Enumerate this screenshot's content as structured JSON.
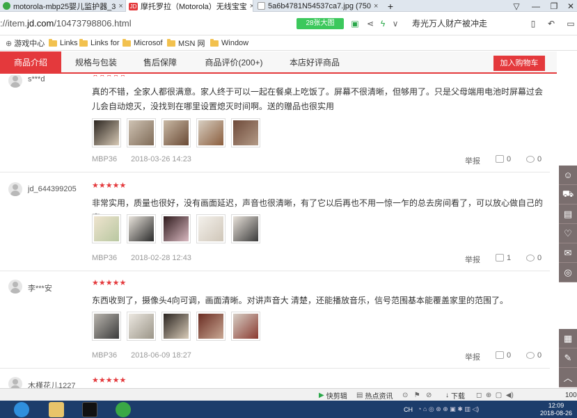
{
  "browser": {
    "tabs": [
      {
        "title": "motorola-mbp25婴儿监护器_3",
        "close": "×",
        "active": false,
        "favicon_color": "#3aa845"
      },
      {
        "title": "摩托罗拉（Motorola）无线宝宝",
        "close": "×",
        "active": true,
        "favicon_label": "JD",
        "favicon_color": "#e4393c"
      },
      {
        "title": "5a6b4781N54537ca7.jpg (750",
        "close": "×",
        "active": false,
        "favicon_color": "#bbbbbb"
      }
    ],
    "new_tab": "+",
    "window_buttons": [
      "▽",
      "—",
      "❐",
      "✕"
    ],
    "url_prefix": "://item.",
    "url_domain": "jd.com",
    "url_suffix": "/10473798806.html",
    "big_image_button": "28张大图",
    "address_icons": [
      "image-icon",
      "share-icon",
      "lightning-icon",
      "chevron-down-icon"
    ],
    "news_text": "寿光万人财产被冲走",
    "toolbar_icons": [
      "phone-icon",
      "undo-icon",
      "bookmark-icon"
    ]
  },
  "bookmarks": [
    {
      "label": "游戏中心",
      "icon": "gamepad-icon"
    },
    {
      "label": "Links",
      "icon": "folder-icon"
    },
    {
      "label": "Links for",
      "icon": "folder-icon"
    },
    {
      "label": "Microsof",
      "icon": "folder-icon"
    },
    {
      "label": "MSN 网",
      "icon": "folder-icon"
    },
    {
      "label": "Window",
      "icon": "folder-icon"
    }
  ],
  "nav": {
    "tabs": [
      "商品介绍",
      "规格与包装",
      "售后保障",
      "商品评价(200+)",
      "本店好评商品"
    ],
    "active_index": 0,
    "cart_button": "加入购物车"
  },
  "reviews": [
    {
      "user": "s***d",
      "stars": "★★★★★",
      "text": "真的不错，全家人都很满意。家人终于可以一起在餐桌上吃饭了。屏幕不很清晰，但够用了。只是父母端用电池时屏幕过会儿会自动熄灭，没找到在哪里设置熄灭时间啊。送的赠品也很实用",
      "thumb_colors": [
        [
          "#2b2520",
          "#d7c9b5"
        ],
        [
          "#cfc3b4",
          "#7f6b57"
        ],
        [
          "#c9b9a5",
          "#6a4a35"
        ],
        [
          "#d8cfc2",
          "#8a5d3d"
        ],
        [
          "#6e4a3a",
          "#b39a86"
        ]
      ],
      "model": "MBP36",
      "date": "2018-03-26 14:23",
      "report": "举报",
      "likes": "0",
      "comments": "0"
    },
    {
      "user": "jd_644399205",
      "stars": "★★★★★",
      "text": "非常实用，质量也很好，没有画面延迟，声音也很清晰，有了它以后再也不用一惊一乍的总去房间看了，可以放心做自己的事。",
      "thumb_colors": [
        [
          "#efe4cf",
          "#b8c7a0"
        ],
        [
          "#e9e4dc",
          "#2a2a2a"
        ],
        [
          "#2e1a1c",
          "#d9b8c0"
        ],
        [
          "#f4f1ec",
          "#cfc6b8"
        ],
        [
          "#e8e2da",
          "#3b3b3b"
        ]
      ],
      "model": "MBP36",
      "date": "2018-02-28 12:43",
      "report": "举报",
      "likes": "1",
      "comments": "0"
    },
    {
      "user": "李***安",
      "stars": "★★★★★",
      "text": "东西收到了，摄像头4向可调，画面清晰。对讲声音大 清楚，还能播放音乐，信号范围基本能覆盖家里的范围了。",
      "thumb_colors": [
        [
          "#b9b5ae",
          "#3b3b3b"
        ],
        [
          "#ece8e1",
          "#9b9588"
        ],
        [
          "#2a2420",
          "#d8cbb8"
        ],
        [
          "#6a2c22",
          "#c9a894"
        ],
        [
          "#d7cfc6",
          "#8a3a30"
        ]
      ],
      "model": "MBP36",
      "date": "2018-06-09 18:27",
      "report": "举报",
      "likes": "0",
      "comments": "0"
    },
    {
      "user": "木槿花儿1227",
      "stars": "★★★★★"
    }
  ],
  "side_tools": [
    "user-icon",
    "cart-icon",
    "coupon-icon",
    "heart-icon",
    "message-icon",
    "feedback-icon"
  ],
  "side_tools_bottom": [
    "qr-icon",
    "edit-icon",
    "top-icon"
  ],
  "statusbar": {
    "items": [
      {
        "label": "快剪辑",
        "icon": "play-icon"
      },
      {
        "label": "热点资讯",
        "icon": "news-icon"
      }
    ],
    "download": "下载",
    "zoom": "100"
  },
  "taskbar": {
    "lang": "CH",
    "time": "12:09",
    "date": "2018-08-26"
  }
}
